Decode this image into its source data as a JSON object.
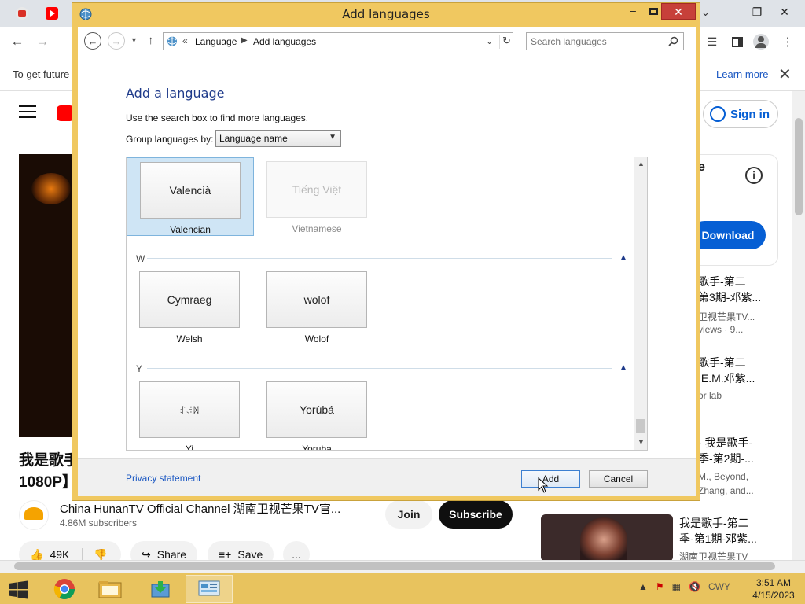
{
  "browser": {
    "infobar_text": "To get future",
    "infobar_link": "Learn more",
    "sign_in": "Sign in",
    "video_title_line1": "我是歌手",
    "video_title_line2": "1080P】",
    "channel_name": "China HunanTV Official Channel 湖南卫视芒果TV官...",
    "subscribers": "4.86M subscribers",
    "join": "Join",
    "subscribe": "Subscribe",
    "likes": "49K",
    "share": "Share",
    "save": "Save",
    "more": "...",
    "side_title": "e",
    "download": "Download",
    "recs": [
      {
        "line1": "歌手-第二",
        "line2": "第3期-邓紫...",
        "sub1": "卫视芒果TV...",
        "sub2": "views · 9..."
      },
      {
        "line1": "歌手-第二",
        "line2": ".E.M.邓紫...",
        "sub1": "or lab",
        "sub2": ""
      },
      {
        "line1": "- 我是歌手-",
        "line2": "季-第2期-...",
        "sub1": "M., Beyond,",
        "sub2": "Zhang, and..."
      },
      {
        "line1": "我是歌手-第二",
        "line2": "季-第1期-邓紫...",
        "sub1": "湖南卫视芒果TV",
        "sub2": ""
      }
    ]
  },
  "dialog": {
    "title": "Add languages",
    "breadcrumb": [
      "Language",
      "Add languages"
    ],
    "search_placeholder": "Search languages",
    "heading": "Add a language",
    "instruction": "Use the search box to find more languages.",
    "group_label": "Group languages by:",
    "group_value": "Language name",
    "groups": [
      {
        "letter": "",
        "tiles": [
          {
            "native": "Valencià",
            "caption": "Valencian",
            "selected": true,
            "disabled": false
          },
          {
            "native": "Tiếng Việt",
            "caption": "Vietnamese",
            "selected": false,
            "disabled": true
          }
        ]
      },
      {
        "letter": "W",
        "tiles": [
          {
            "native": "Cymraeg",
            "caption": "Welsh",
            "selected": false,
            "disabled": false
          },
          {
            "native": "wolof",
            "caption": "Wolof",
            "selected": false,
            "disabled": false
          }
        ]
      },
      {
        "letter": "Y",
        "tiles": [
          {
            "native": "ꆈꌠꉙ",
            "caption": "Yi",
            "selected": false,
            "disabled": false
          },
          {
            "native": "Yorùbá",
            "caption": "Yoruba",
            "selected": false,
            "disabled": false
          }
        ]
      }
    ],
    "privacy": "Privacy statement",
    "add": "Add",
    "cancel": "Cancel"
  },
  "taskbar": {
    "tray_lang": "CWY",
    "time": "3:51 AM",
    "date": "4/15/2023"
  },
  "colors": {
    "dialog_frame": "#f0c860",
    "taskbar": "#e8c35e",
    "close_red": "#c7403a",
    "link_blue": "#1a57c2",
    "yt_blue": "#065fd4"
  }
}
